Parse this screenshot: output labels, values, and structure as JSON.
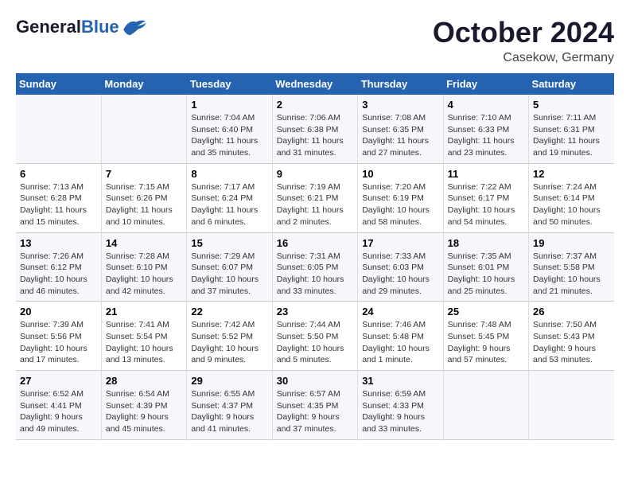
{
  "header": {
    "logo_line1": "General",
    "logo_line2": "Blue",
    "month": "October 2024",
    "location": "Casekow, Germany"
  },
  "days_of_week": [
    "Sunday",
    "Monday",
    "Tuesday",
    "Wednesday",
    "Thursday",
    "Friday",
    "Saturday"
  ],
  "weeks": [
    [
      {
        "day": "",
        "sunrise": "",
        "sunset": "",
        "daylight": ""
      },
      {
        "day": "",
        "sunrise": "",
        "sunset": "",
        "daylight": ""
      },
      {
        "day": "1",
        "sunrise": "Sunrise: 7:04 AM",
        "sunset": "Sunset: 6:40 PM",
        "daylight": "Daylight: 11 hours and 35 minutes."
      },
      {
        "day": "2",
        "sunrise": "Sunrise: 7:06 AM",
        "sunset": "Sunset: 6:38 PM",
        "daylight": "Daylight: 11 hours and 31 minutes."
      },
      {
        "day": "3",
        "sunrise": "Sunrise: 7:08 AM",
        "sunset": "Sunset: 6:35 PM",
        "daylight": "Daylight: 11 hours and 27 minutes."
      },
      {
        "day": "4",
        "sunrise": "Sunrise: 7:10 AM",
        "sunset": "Sunset: 6:33 PM",
        "daylight": "Daylight: 11 hours and 23 minutes."
      },
      {
        "day": "5",
        "sunrise": "Sunrise: 7:11 AM",
        "sunset": "Sunset: 6:31 PM",
        "daylight": "Daylight: 11 hours and 19 minutes."
      }
    ],
    [
      {
        "day": "6",
        "sunrise": "Sunrise: 7:13 AM",
        "sunset": "Sunset: 6:28 PM",
        "daylight": "Daylight: 11 hours and 15 minutes."
      },
      {
        "day": "7",
        "sunrise": "Sunrise: 7:15 AM",
        "sunset": "Sunset: 6:26 PM",
        "daylight": "Daylight: 11 hours and 10 minutes."
      },
      {
        "day": "8",
        "sunrise": "Sunrise: 7:17 AM",
        "sunset": "Sunset: 6:24 PM",
        "daylight": "Daylight: 11 hours and 6 minutes."
      },
      {
        "day": "9",
        "sunrise": "Sunrise: 7:19 AM",
        "sunset": "Sunset: 6:21 PM",
        "daylight": "Daylight: 11 hours and 2 minutes."
      },
      {
        "day": "10",
        "sunrise": "Sunrise: 7:20 AM",
        "sunset": "Sunset: 6:19 PM",
        "daylight": "Daylight: 10 hours and 58 minutes."
      },
      {
        "day": "11",
        "sunrise": "Sunrise: 7:22 AM",
        "sunset": "Sunset: 6:17 PM",
        "daylight": "Daylight: 10 hours and 54 minutes."
      },
      {
        "day": "12",
        "sunrise": "Sunrise: 7:24 AM",
        "sunset": "Sunset: 6:14 PM",
        "daylight": "Daylight: 10 hours and 50 minutes."
      }
    ],
    [
      {
        "day": "13",
        "sunrise": "Sunrise: 7:26 AM",
        "sunset": "Sunset: 6:12 PM",
        "daylight": "Daylight: 10 hours and 46 minutes."
      },
      {
        "day": "14",
        "sunrise": "Sunrise: 7:28 AM",
        "sunset": "Sunset: 6:10 PM",
        "daylight": "Daylight: 10 hours and 42 minutes."
      },
      {
        "day": "15",
        "sunrise": "Sunrise: 7:29 AM",
        "sunset": "Sunset: 6:07 PM",
        "daylight": "Daylight: 10 hours and 37 minutes."
      },
      {
        "day": "16",
        "sunrise": "Sunrise: 7:31 AM",
        "sunset": "Sunset: 6:05 PM",
        "daylight": "Daylight: 10 hours and 33 minutes."
      },
      {
        "day": "17",
        "sunrise": "Sunrise: 7:33 AM",
        "sunset": "Sunset: 6:03 PM",
        "daylight": "Daylight: 10 hours and 29 minutes."
      },
      {
        "day": "18",
        "sunrise": "Sunrise: 7:35 AM",
        "sunset": "Sunset: 6:01 PM",
        "daylight": "Daylight: 10 hours and 25 minutes."
      },
      {
        "day": "19",
        "sunrise": "Sunrise: 7:37 AM",
        "sunset": "Sunset: 5:58 PM",
        "daylight": "Daylight: 10 hours and 21 minutes."
      }
    ],
    [
      {
        "day": "20",
        "sunrise": "Sunrise: 7:39 AM",
        "sunset": "Sunset: 5:56 PM",
        "daylight": "Daylight: 10 hours and 17 minutes."
      },
      {
        "day": "21",
        "sunrise": "Sunrise: 7:41 AM",
        "sunset": "Sunset: 5:54 PM",
        "daylight": "Daylight: 10 hours and 13 minutes."
      },
      {
        "day": "22",
        "sunrise": "Sunrise: 7:42 AM",
        "sunset": "Sunset: 5:52 PM",
        "daylight": "Daylight: 10 hours and 9 minutes."
      },
      {
        "day": "23",
        "sunrise": "Sunrise: 7:44 AM",
        "sunset": "Sunset: 5:50 PM",
        "daylight": "Daylight: 10 hours and 5 minutes."
      },
      {
        "day": "24",
        "sunrise": "Sunrise: 7:46 AM",
        "sunset": "Sunset: 5:48 PM",
        "daylight": "Daylight: 10 hours and 1 minute."
      },
      {
        "day": "25",
        "sunrise": "Sunrise: 7:48 AM",
        "sunset": "Sunset: 5:45 PM",
        "daylight": "Daylight: 9 hours and 57 minutes."
      },
      {
        "day": "26",
        "sunrise": "Sunrise: 7:50 AM",
        "sunset": "Sunset: 5:43 PM",
        "daylight": "Daylight: 9 hours and 53 minutes."
      }
    ],
    [
      {
        "day": "27",
        "sunrise": "Sunrise: 6:52 AM",
        "sunset": "Sunset: 4:41 PM",
        "daylight": "Daylight: 9 hours and 49 minutes."
      },
      {
        "day": "28",
        "sunrise": "Sunrise: 6:54 AM",
        "sunset": "Sunset: 4:39 PM",
        "daylight": "Daylight: 9 hours and 45 minutes."
      },
      {
        "day": "29",
        "sunrise": "Sunrise: 6:55 AM",
        "sunset": "Sunset: 4:37 PM",
        "daylight": "Daylight: 9 hours and 41 minutes."
      },
      {
        "day": "30",
        "sunrise": "Sunrise: 6:57 AM",
        "sunset": "Sunset: 4:35 PM",
        "daylight": "Daylight: 9 hours and 37 minutes."
      },
      {
        "day": "31",
        "sunrise": "Sunrise: 6:59 AM",
        "sunset": "Sunset: 4:33 PM",
        "daylight": "Daylight: 9 hours and 33 minutes."
      },
      {
        "day": "",
        "sunrise": "",
        "sunset": "",
        "daylight": ""
      },
      {
        "day": "",
        "sunrise": "",
        "sunset": "",
        "daylight": ""
      }
    ]
  ]
}
